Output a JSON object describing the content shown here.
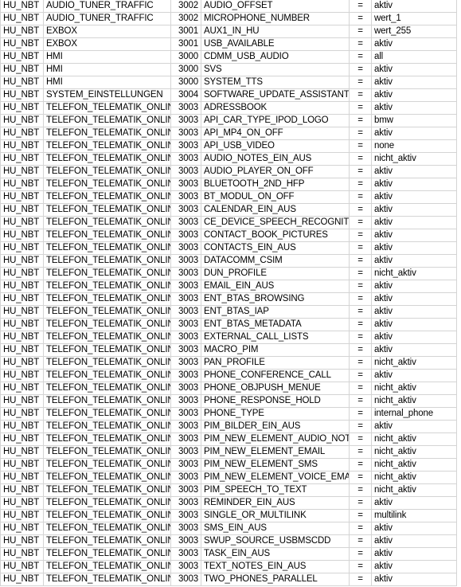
{
  "sheet": {
    "rows": [
      {
        "device": "HU_NBT",
        "group": "AUDIO_TUNER_TRAFFIC",
        "id": "3002",
        "param": "AUDIO_OFFSET",
        "op": "=",
        "value": "aktiv"
      },
      {
        "device": "HU_NBT",
        "group": "AUDIO_TUNER_TRAFFIC",
        "id": "3002",
        "param": "MICROPHONE_NUMBER",
        "op": "=",
        "value": "wert_1"
      },
      {
        "device": "HU_NBT",
        "group": "EXBOX",
        "id": "3001",
        "param": "AUX1_IN_HU",
        "op": "=",
        "value": "wert_255"
      },
      {
        "device": "HU_NBT",
        "group": "EXBOX",
        "id": "3001",
        "param": "USB_AVAILABLE",
        "op": "=",
        "value": "aktiv"
      },
      {
        "device": "HU_NBT",
        "group": "HMI",
        "id": "3000",
        "param": "CDMM_USB_AUDIO",
        "op": "=",
        "value": "all"
      },
      {
        "device": "HU_NBT",
        "group": "HMI",
        "id": "3000",
        "param": "SVS",
        "op": "=",
        "value": "aktiv"
      },
      {
        "device": "HU_NBT",
        "group": "HMI",
        "id": "3000",
        "param": "SYSTEM_TTS",
        "op": "=",
        "value": "aktiv"
      },
      {
        "device": "HU_NBT",
        "group": "SYSTEM_EINSTELLUNGEN",
        "id": "3004",
        "param": "SOFTWARE_UPDATE_ASSISTANT",
        "op": "=",
        "value": "aktiv"
      },
      {
        "device": "HU_NBT",
        "group": "TELEFON_TELEMATIK_ONLINE",
        "id": "3003",
        "param": "ADRESSBOOK",
        "op": "=",
        "value": "aktiv"
      },
      {
        "device": "HU_NBT",
        "group": "TELEFON_TELEMATIK_ONLINE",
        "id": "3003",
        "param": "API_CAR_TYPE_IPOD_LOGO",
        "op": "=",
        "value": "bmw"
      },
      {
        "device": "HU_NBT",
        "group": "TELEFON_TELEMATIK_ONLINE",
        "id": "3003",
        "param": "API_MP4_ON_OFF",
        "op": "=",
        "value": "aktiv"
      },
      {
        "device": "HU_NBT",
        "group": "TELEFON_TELEMATIK_ONLINE",
        "id": "3003",
        "param": "API_USB_VIDEO",
        "op": "=",
        "value": "none"
      },
      {
        "device": "HU_NBT",
        "group": "TELEFON_TELEMATIK_ONLINE",
        "id": "3003",
        "param": "AUDIO_NOTES_EIN_AUS",
        "op": "=",
        "value": "nicht_aktiv"
      },
      {
        "device": "HU_NBT",
        "group": "TELEFON_TELEMATIK_ONLINE",
        "id": "3003",
        "param": "AUDIO_PLAYER_ON_OFF",
        "op": "=",
        "value": "aktiv"
      },
      {
        "device": "HU_NBT",
        "group": "TELEFON_TELEMATIK_ONLINE",
        "id": "3003",
        "param": "BLUETOOTH_2ND_HFP",
        "op": "=",
        "value": "aktiv"
      },
      {
        "device": "HU_NBT",
        "group": "TELEFON_TELEMATIK_ONLINE",
        "id": "3003",
        "param": "BT_MODUL_ON_OFF",
        "op": "=",
        "value": "aktiv"
      },
      {
        "device": "HU_NBT",
        "group": "TELEFON_TELEMATIK_ONLINE",
        "id": "3003",
        "param": "CALENDAR_EIN_AUS",
        "op": "=",
        "value": "aktiv"
      },
      {
        "device": "HU_NBT",
        "group": "TELEFON_TELEMATIK_ONLINE",
        "id": "3003",
        "param": "CE_DEVICE_SPEECH_RECOGNITION",
        "op": "=",
        "value": "aktiv"
      },
      {
        "device": "HU_NBT",
        "group": "TELEFON_TELEMATIK_ONLINE",
        "id": "3003",
        "param": "CONTACT_BOOK_PICTURES",
        "op": "=",
        "value": "aktiv"
      },
      {
        "device": "HU_NBT",
        "group": "TELEFON_TELEMATIK_ONLINE",
        "id": "3003",
        "param": "CONTACTS_EIN_AUS",
        "op": "=",
        "value": "aktiv"
      },
      {
        "device": "HU_NBT",
        "group": "TELEFON_TELEMATIK_ONLINE",
        "id": "3003",
        "param": "DATACOMM_CSIM",
        "op": "=",
        "value": "aktiv"
      },
      {
        "device": "HU_NBT",
        "group": "TELEFON_TELEMATIK_ONLINE",
        "id": "3003",
        "param": "DUN_PROFILE",
        "op": "=",
        "value": "nicht_aktiv"
      },
      {
        "device": "HU_NBT",
        "group": "TELEFON_TELEMATIK_ONLINE",
        "id": "3003",
        "param": "EMAIL_EIN_AUS",
        "op": "=",
        "value": "aktiv"
      },
      {
        "device": "HU_NBT",
        "group": "TELEFON_TELEMATIK_ONLINE",
        "id": "3003",
        "param": "ENT_BTAS_BROWSING",
        "op": "=",
        "value": "aktiv"
      },
      {
        "device": "HU_NBT",
        "group": "TELEFON_TELEMATIK_ONLINE",
        "id": "3003",
        "param": "ENT_BTAS_IAP",
        "op": "=",
        "value": "aktiv"
      },
      {
        "device": "HU_NBT",
        "group": "TELEFON_TELEMATIK_ONLINE",
        "id": "3003",
        "param": "ENT_BTAS_METADATA",
        "op": "=",
        "value": "aktiv"
      },
      {
        "device": "HU_NBT",
        "group": "TELEFON_TELEMATIK_ONLINE",
        "id": "3003",
        "param": "EXTERNAL_CALL_LISTS",
        "op": "=",
        "value": "aktiv"
      },
      {
        "device": "HU_NBT",
        "group": "TELEFON_TELEMATIK_ONLINE",
        "id": "3003",
        "param": "MACRO_PIM",
        "op": "=",
        "value": "aktiv"
      },
      {
        "device": "HU_NBT",
        "group": "TELEFON_TELEMATIK_ONLINE",
        "id": "3003",
        "param": "PAN_PROFILE",
        "op": "=",
        "value": "nicht_aktiv"
      },
      {
        "device": "HU_NBT",
        "group": "TELEFON_TELEMATIK_ONLINE",
        "id": "3003",
        "param": "PHONE_CONFERENCE_CALL",
        "op": "=",
        "value": "aktiv"
      },
      {
        "device": "HU_NBT",
        "group": "TELEFON_TELEMATIK_ONLINE",
        "id": "3003",
        "param": "PHONE_OBJPUSH_MENUE",
        "op": "=",
        "value": "nicht_aktiv"
      },
      {
        "device": "HU_NBT",
        "group": "TELEFON_TELEMATIK_ONLINE",
        "id": "3003",
        "param": "PHONE_RESPONSE_HOLD",
        "op": "=",
        "value": "nicht_aktiv"
      },
      {
        "device": "HU_NBT",
        "group": "TELEFON_TELEMATIK_ONLINE",
        "id": "3003",
        "param": "PHONE_TYPE",
        "op": "=",
        "value": "internal_phone"
      },
      {
        "device": "HU_NBT",
        "group": "TELEFON_TELEMATIK_ONLINE",
        "id": "3003",
        "param": "PIM_BILDER_EIN_AUS",
        "op": "=",
        "value": "aktiv"
      },
      {
        "device": "HU_NBT",
        "group": "TELEFON_TELEMATIK_ONLINE",
        "id": "3003",
        "param": "PIM_NEW_ELEMENT_AUDIO_NOTE",
        "op": "=",
        "value": "nicht_aktiv"
      },
      {
        "device": "HU_NBT",
        "group": "TELEFON_TELEMATIK_ONLINE",
        "id": "3003",
        "param": "PIM_NEW_ELEMENT_EMAIL",
        "op": "=",
        "value": "nicht_aktiv"
      },
      {
        "device": "HU_NBT",
        "group": "TELEFON_TELEMATIK_ONLINE",
        "id": "3003",
        "param": "PIM_NEW_ELEMENT_SMS",
        "op": "=",
        "value": "nicht_aktiv"
      },
      {
        "device": "HU_NBT",
        "group": "TELEFON_TELEMATIK_ONLINE",
        "id": "3003",
        "param": "PIM_NEW_ELEMENT_VOICE_EMAIL",
        "op": "=",
        "value": "nicht_aktiv"
      },
      {
        "device": "HU_NBT",
        "group": "TELEFON_TELEMATIK_ONLINE",
        "id": "3003",
        "param": "PIM_SPEECH_TO_TEXT",
        "op": "=",
        "value": "nicht_aktiv"
      },
      {
        "device": "HU_NBT",
        "group": "TELEFON_TELEMATIK_ONLINE",
        "id": "3003",
        "param": "REMINDER_EIN_AUS",
        "op": "=",
        "value": "aktiv"
      },
      {
        "device": "HU_NBT",
        "group": "TELEFON_TELEMATIK_ONLINE",
        "id": "3003",
        "param": "SINGLE_OR_MULTILINK",
        "op": "=",
        "value": "multilink"
      },
      {
        "device": "HU_NBT",
        "group": "TELEFON_TELEMATIK_ONLINE",
        "id": "3003",
        "param": "SMS_EIN_AUS",
        "op": "=",
        "value": "aktiv"
      },
      {
        "device": "HU_NBT",
        "group": "TELEFON_TELEMATIK_ONLINE",
        "id": "3003",
        "param": "SWUP_SOURCE_USBMSCDD",
        "op": "=",
        "value": "aktiv"
      },
      {
        "device": "HU_NBT",
        "group": "TELEFON_TELEMATIK_ONLINE",
        "id": "3003",
        "param": "TASK_EIN_AUS",
        "op": "=",
        "value": "aktiv"
      },
      {
        "device": "HU_NBT",
        "group": "TELEFON_TELEMATIK_ONLINE",
        "id": "3003",
        "param": "TEXT_NOTES_EIN_AUS",
        "op": "=",
        "value": "aktiv"
      },
      {
        "device": "HU_NBT",
        "group": "TELEFON_TELEMATIK_ONLINE",
        "id": "3003",
        "param": "TWO_PHONES_PARALLEL",
        "op": "=",
        "value": "aktiv"
      }
    ]
  }
}
